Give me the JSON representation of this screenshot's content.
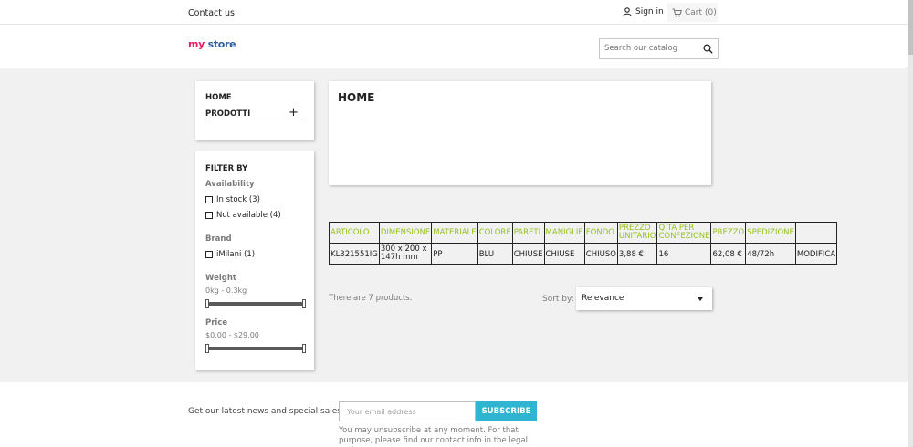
{
  "topbar": {
    "contact": "Contact us",
    "signin": "Sign in",
    "cart": "Cart",
    "cart_count": "(0)"
  },
  "header": {
    "logo_words": [
      "my",
      "store"
    ],
    "search_placeholder": "Search our catalog"
  },
  "sidebar": {
    "categories": {
      "home": "HOME",
      "products": "PRODOTTI",
      "expand": "+"
    },
    "filters": {
      "title": "FILTER BY",
      "availability_label": "Availability",
      "availability_options": [
        "In stock (3)",
        "Not available (4)"
      ],
      "brand_label": "Brand",
      "brand_options": [
        "iMilani (1)"
      ],
      "weight_label": "Weight",
      "weight_range": "0kg - 0.3kg",
      "price_label": "Price",
      "price_range": "$0.00 - $29.00"
    }
  },
  "main": {
    "title": "HOME",
    "table": {
      "headers": [
        "ARTICOLO",
        "DIMENSIONE",
        "MATERIALE",
        "COLORE",
        "PARETI",
        "MANIGLIE",
        "FONDO",
        "PREZZO UNITARIO",
        "Q.TA PER CONFEZIONE",
        "PREZZO",
        "SPEDIZIONE",
        ""
      ],
      "row": [
        "KL321551IG",
        "300 x 200 x 147h mm",
        "PP",
        "BLU",
        "CHIUSE",
        "CHIUSE",
        "CHIUSO",
        "3,88 €",
        "16",
        "62,08 €",
        "48/72h",
        "MODIFICA"
      ]
    },
    "product_count": "There are 7 products.",
    "sort_label": "Sort by:",
    "sort_value": "Relevance"
  },
  "footer": {
    "newsletter_text": "Get our latest news and special sales",
    "email_placeholder": "Your email address",
    "subscribe_label": "SUBSCRIBE",
    "note": "You may unsubscribe at any moment. For that purpose, please find our contact info in the legal notice."
  },
  "colors": {
    "accent": "#2fb5d2",
    "table_header": "#95c11f",
    "logo_m": "#e91e63",
    "logo_y": "#2fb5d2"
  }
}
